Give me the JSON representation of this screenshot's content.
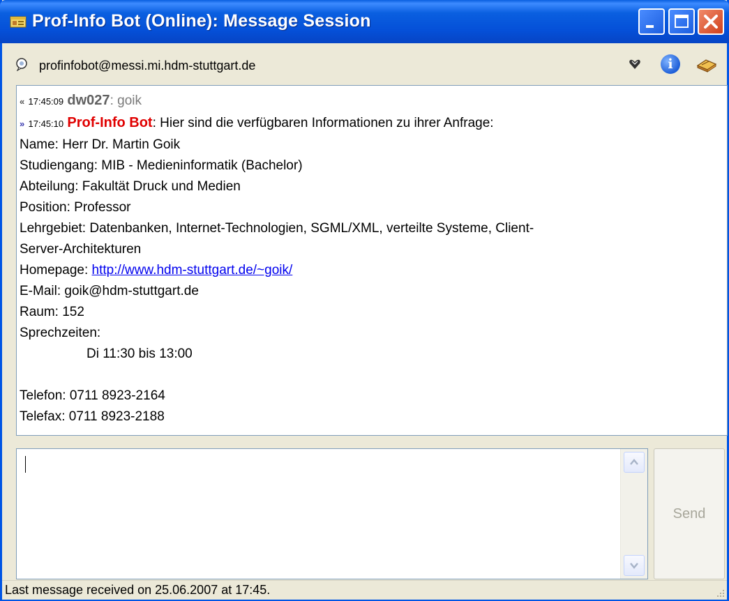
{
  "window": {
    "title": "Prof-Info Bot (Online): Message Session",
    "title_icon": "contact-card-icon",
    "controls": [
      "minimize-icon",
      "maximize-icon",
      "close-icon"
    ]
  },
  "contact": {
    "address": "profinfobot@messi.mi.hdm-stuttgart.de",
    "icons": [
      "presence-bulb-icon",
      "heart-icon",
      "info-icon",
      "book-icon"
    ]
  },
  "history": {
    "messages": [
      {
        "direction": "in",
        "time": "17:45:09",
        "sender": "dw027",
        "text": "goik"
      },
      {
        "direction": "out",
        "time": "17:45:10",
        "sender": "Prof-Info Bot",
        "text": "Hier sind die verfügbaren Informationen zu ihrer Anfrage:"
      }
    ],
    "separator": ": ",
    "lines": {
      "name": "Name: Herr Dr. Martin Goik",
      "studiengang": "Studiengang: MIB - Medieninformatik (Bachelor)",
      "abteilung": "Abteilung: Fakultät Druck und Medien",
      "position": "Position: Professor",
      "lehrgebiet_1": "Lehrgebiet: Datenbanken, Internet-Technologien, SGML/XML, verteilte Systeme, Client-",
      "lehrgebiet_2": "Server-Architekturen",
      "homepage_label": "Homepage: ",
      "homepage_url": "http://www.hdm-stuttgart.de/~goik/",
      "email": "E-Mail: goik@hdm-stuttgart.de",
      "raum": "Raum: 152",
      "sprechzeiten": "Sprechzeiten:",
      "sprechzeiten_value": "Di 11:30 bis 13:00",
      "telefon": "Telefon: 0711 8923-2164",
      "telefax": "Telefax: 0711 8923-2188"
    }
  },
  "input": {
    "value": ""
  },
  "send_label": "Send",
  "status": {
    "text": "Last message received on 25.06.2007 at 17:45."
  },
  "colors": {
    "titlebar": "#0A5FE0",
    "bot_nick": "#E00000",
    "user_nick": "#606060",
    "link": "#0000EE"
  }
}
